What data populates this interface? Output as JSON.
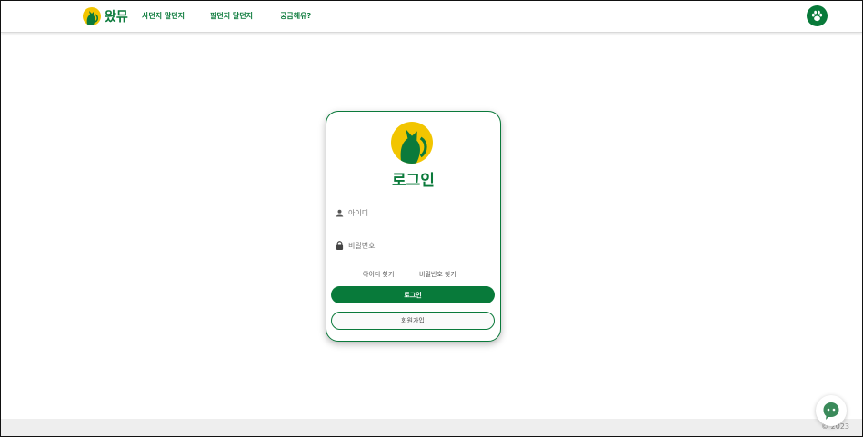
{
  "header": {
    "logo_text": "왔뮤",
    "nav": [
      "사던지 말던지",
      "팔던지 말던지",
      "궁금해유?"
    ],
    "paw_icon": "paw-icon"
  },
  "login": {
    "title": "로그인",
    "id_placeholder": "아이디",
    "pw_placeholder": "비밀번호",
    "find_id": "아이디 찾기",
    "find_pw": "비밀번호 찾기",
    "login_button": "로그인",
    "signup_button": "회원가입"
  },
  "footer": {
    "copyright": "© 2023"
  },
  "colors": {
    "brand_green": "#0b7a3b",
    "brand_yellow": "#f2c500"
  }
}
